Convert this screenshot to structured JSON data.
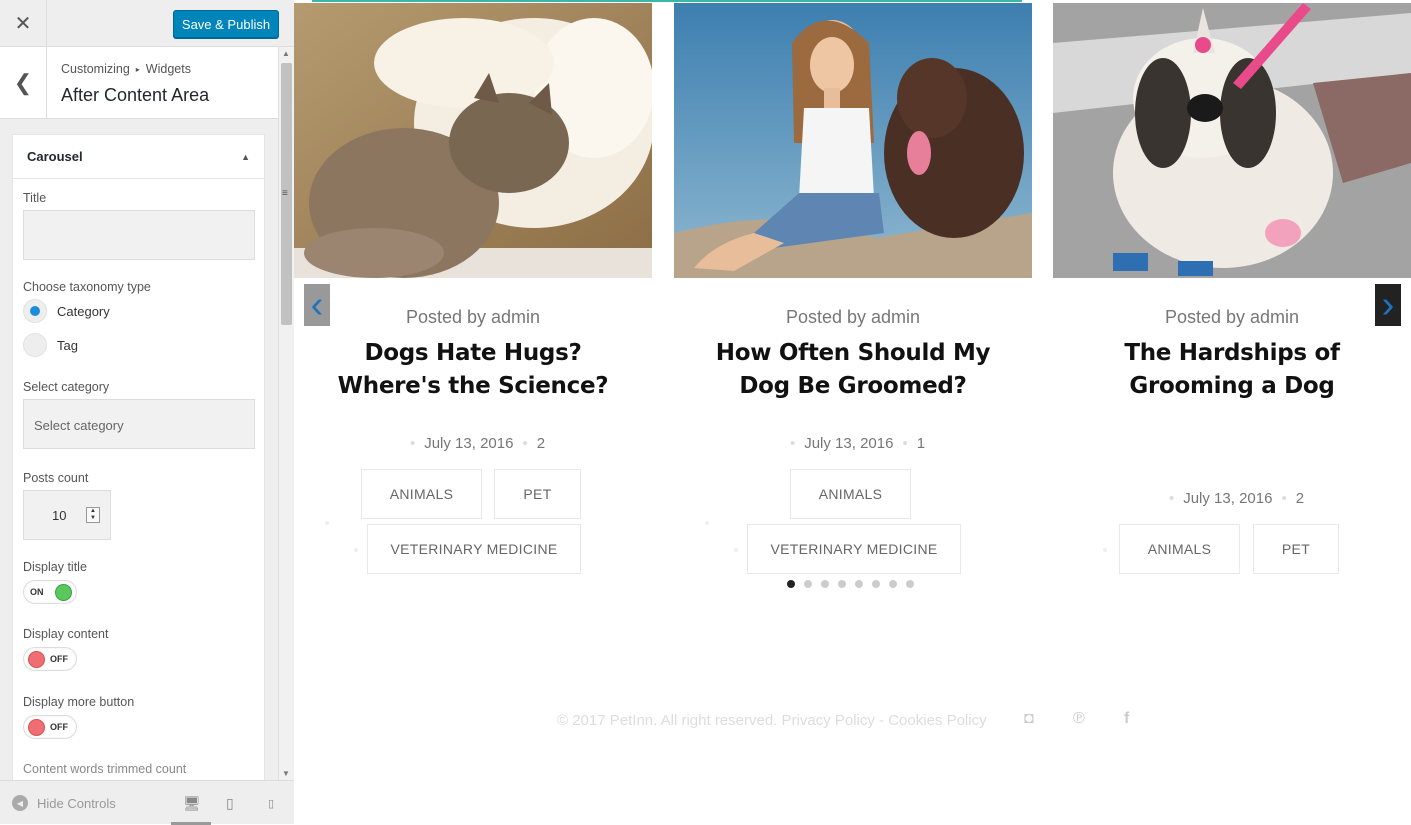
{
  "topbar": {
    "close_symbol": "✕",
    "publish_label": "Save & Publish"
  },
  "section": {
    "back_symbol": "❮",
    "breadcrumb": [
      "Customizing",
      "Widgets"
    ],
    "breadcrumb_sep": "▸",
    "title": "After Content Area"
  },
  "widget": {
    "title": "Carousel",
    "arrow": "▲",
    "fields": {
      "title_label": "Title",
      "title_value": "",
      "taxonomy_label": "Choose taxonomy type",
      "taxonomy_options": [
        "Category",
        "Tag"
      ],
      "taxonomy_selected": "Category",
      "category_label": "Select category",
      "category_placeholder": "Select category",
      "posts_count_label": "Posts count",
      "posts_count_value": "10",
      "display_title_label": "Display title",
      "display_title_state": "ON",
      "display_content_label": "Display content",
      "display_content_state": "OFF",
      "display_more_label": "Display more button",
      "display_more_state": "OFF",
      "trim_label": "Content words trimmed count"
    }
  },
  "footer_controls": {
    "hide_label": "Hide Controls",
    "hide_icon": "◀",
    "devices": [
      "desktop-icon",
      "tablet-icon",
      "mobile-icon"
    ],
    "device_glyphs": [
      "🖥",
      "▯",
      "▯"
    ]
  },
  "carousel": {
    "prev_symbol": "‹",
    "next_symbol": "›",
    "posts": [
      {
        "posted": "Posted by admin",
        "title": "Dogs Hate Hugs? Where's the Science?",
        "date": "July 13, 2016",
        "comments": "2",
        "tags": [
          "ANIMALS",
          "PET",
          "VETERINARY MEDICINE"
        ]
      },
      {
        "posted": "Posted by admin",
        "title": "How Often Should My Dog Be Groomed?",
        "date": "July 13, 2016",
        "comments": "1",
        "tags": [
          "ANIMALS",
          "VETERINARY MEDICINE"
        ]
      },
      {
        "posted": "Posted by admin",
        "title": "The Hardships of Grooming a Dog",
        "date": "July 13, 2016",
        "comments": "2",
        "tags": [
          "ANIMALS",
          "PET"
        ]
      }
    ],
    "dot_count": 8,
    "active_dot": 0
  },
  "site_footer": {
    "copyright": "© 2017 PetInn. All right reserved.",
    "privacy": "Privacy Policy",
    "dash": "-",
    "cookies": "Cookies Policy",
    "social": [
      "instagram-icon",
      "pinterest-icon",
      "facebook-icon"
    ],
    "social_glyphs": [
      "◘",
      "℗",
      "f"
    ]
  },
  "colors": {
    "accent": "#0085ba",
    "toggle_on": "#5bc85f",
    "toggle_off": "#ee6e73",
    "radio": "#1e8cdd",
    "strip": "#3bb7a8"
  }
}
